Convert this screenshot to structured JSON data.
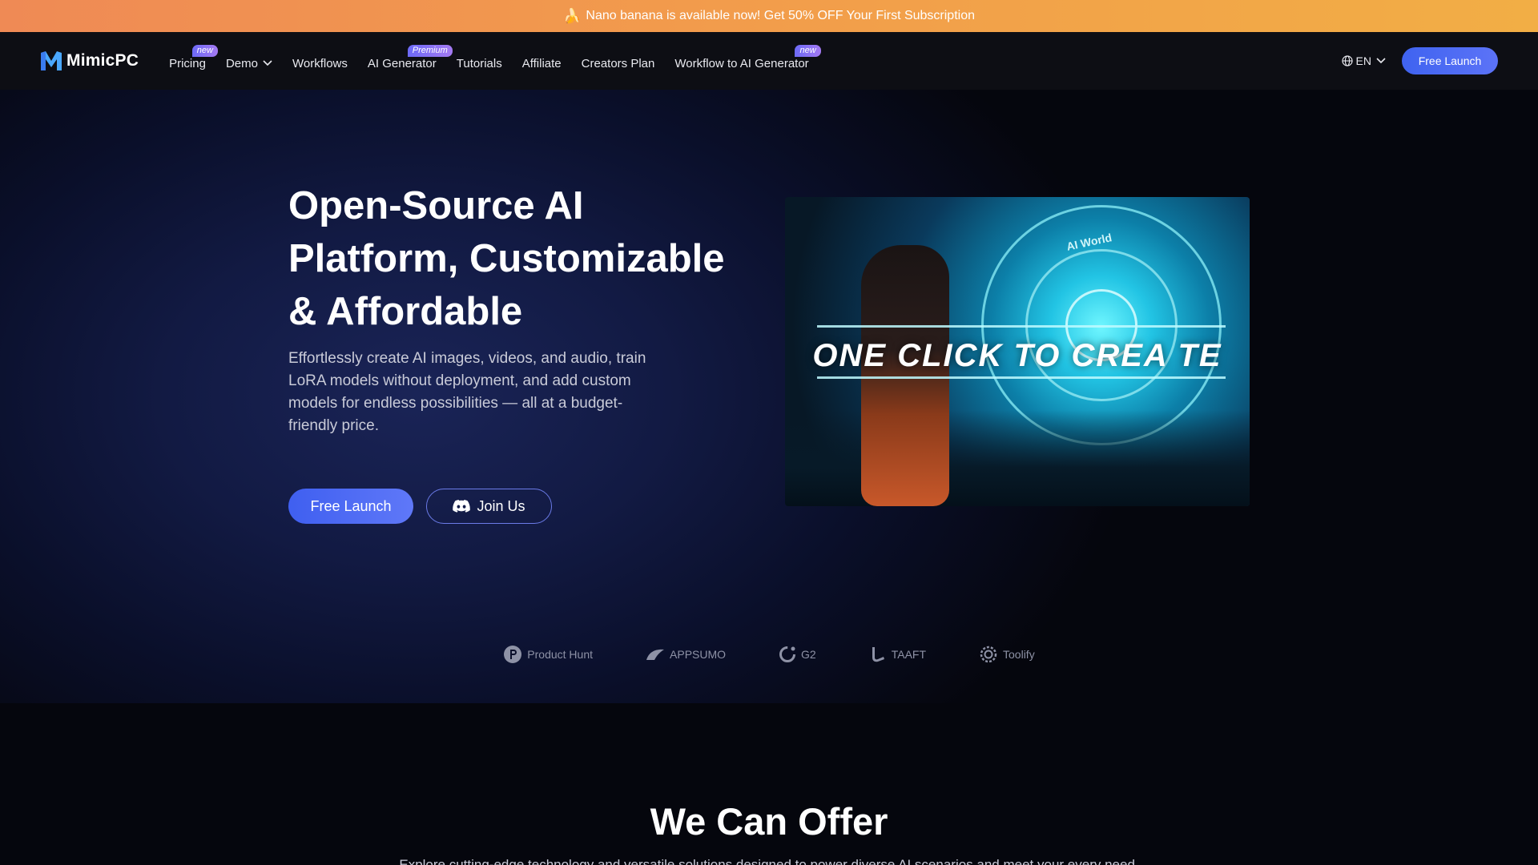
{
  "promo": {
    "text": "Nano banana is available now! Get 50% OFF Your First Subscription",
    "icon": "banana-icon"
  },
  "nav": {
    "logo_text": "MimicPC",
    "items": [
      {
        "label": "Pricing",
        "badge": "new"
      },
      {
        "label": "Demo",
        "has_dropdown": true
      },
      {
        "label": "Workflows"
      },
      {
        "label": "AI Generator",
        "badge": "Premium"
      },
      {
        "label": "Tutorials"
      },
      {
        "label": "Affiliate"
      },
      {
        "label": "Creators Plan"
      },
      {
        "label": "Workflow to AI Generator",
        "badge": "new"
      }
    ],
    "language": "EN",
    "launch_button": "Free Launch"
  },
  "hero": {
    "title": "Open-Source AI Platform, Customizable & Affordable",
    "description": "Effortlessly create AI images, videos, and audio, train LoRA models without deployment, and add custom models for endless possibilities — all at a budget-friendly price.",
    "primary_button": "Free Launch",
    "secondary_button": "Join Us",
    "media": {
      "overlay_text": "ONE CLICK TO CREA TE",
      "portal_label": "AI World"
    }
  },
  "partners": [
    {
      "name": "Product Hunt",
      "icon": "product-hunt-icon"
    },
    {
      "name": "APPSUMO",
      "icon": "appsumo-icon"
    },
    {
      "name": "G2",
      "icon": "g2-icon"
    },
    {
      "name": "TAAFT",
      "icon": "taaft-icon"
    },
    {
      "name": "Toolify",
      "icon": "toolify-icon"
    }
  ],
  "offer": {
    "title": "We Can Offer",
    "subtitle": "Explore cutting-edge technology and versatile solutions designed to power diverse AI scenarios and meet your every need."
  },
  "colors": {
    "accent": "#4a68f3",
    "promo_start": "#ef8a55",
    "promo_end": "#f2ae45",
    "nav_bg": "#0d0e14",
    "badge": "#7d6ff5"
  }
}
